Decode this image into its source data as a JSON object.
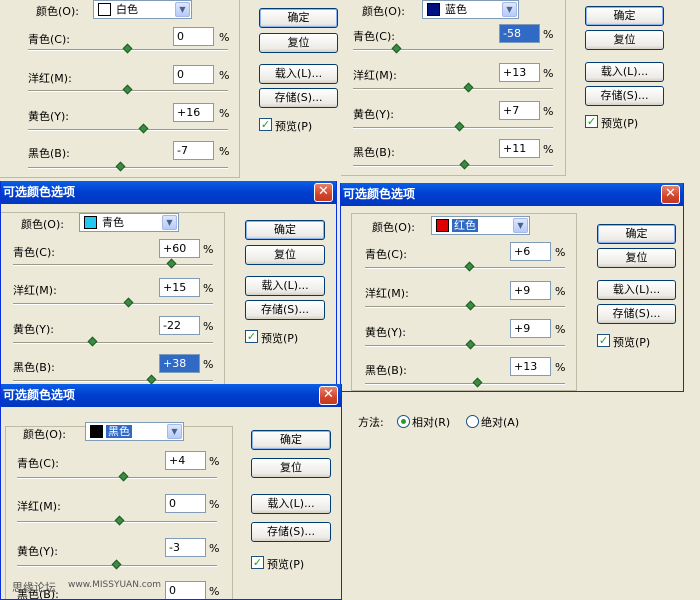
{
  "colors": {
    "titlebar": "#0a5fe6",
    "selection": "#316ac5",
    "slider_thumb": "#3c8a43",
    "dialog_bg": "#ece9d8"
  },
  "dialog_title": "可选颜色选项",
  "close_glyph": "✕",
  "labels": {
    "colors": "颜色(O):",
    "cyan": "青色(C):",
    "magenta": "洋红(M):",
    "yellow": "黄色(Y):",
    "black": "黑色(B):",
    "percent": "%"
  },
  "buttons": {
    "ok": "确定",
    "reset": "复位",
    "load": "载入(L)...",
    "save": "存储(S)...",
    "preview": "预览(P)"
  },
  "method": {
    "label": "方法:",
    "relative": "相对(R)",
    "absolute": "绝对(A)",
    "selected": "relative"
  },
  "panels": [
    {
      "color_name": "白色",
      "swatch": "#ffffff",
      "cyan": "0",
      "magenta": "0",
      "yellow": "+16",
      "black": "-7"
    },
    {
      "color_name": "蓝色",
      "swatch": "#001080",
      "cyan": "-58",
      "magenta": "+13",
      "yellow": "+7",
      "black": "+11"
    },
    {
      "color_name": "青色",
      "swatch": "#22c8f0",
      "cyan": "+60",
      "magenta": "+15",
      "yellow": "-22",
      "black": "+38"
    },
    {
      "color_name": "红色",
      "swatch": "#e00000",
      "cyan": "+6",
      "magenta": "+9",
      "yellow": "+9",
      "black": "+13"
    },
    {
      "color_name": "黑色",
      "swatch": "#000000",
      "cyan": "+4",
      "magenta": "0",
      "yellow": "-3",
      "black": "0"
    }
  ],
  "watermark": {
    "left": "思缘论坛",
    "url": "www.MISSYUAN.com"
  }
}
